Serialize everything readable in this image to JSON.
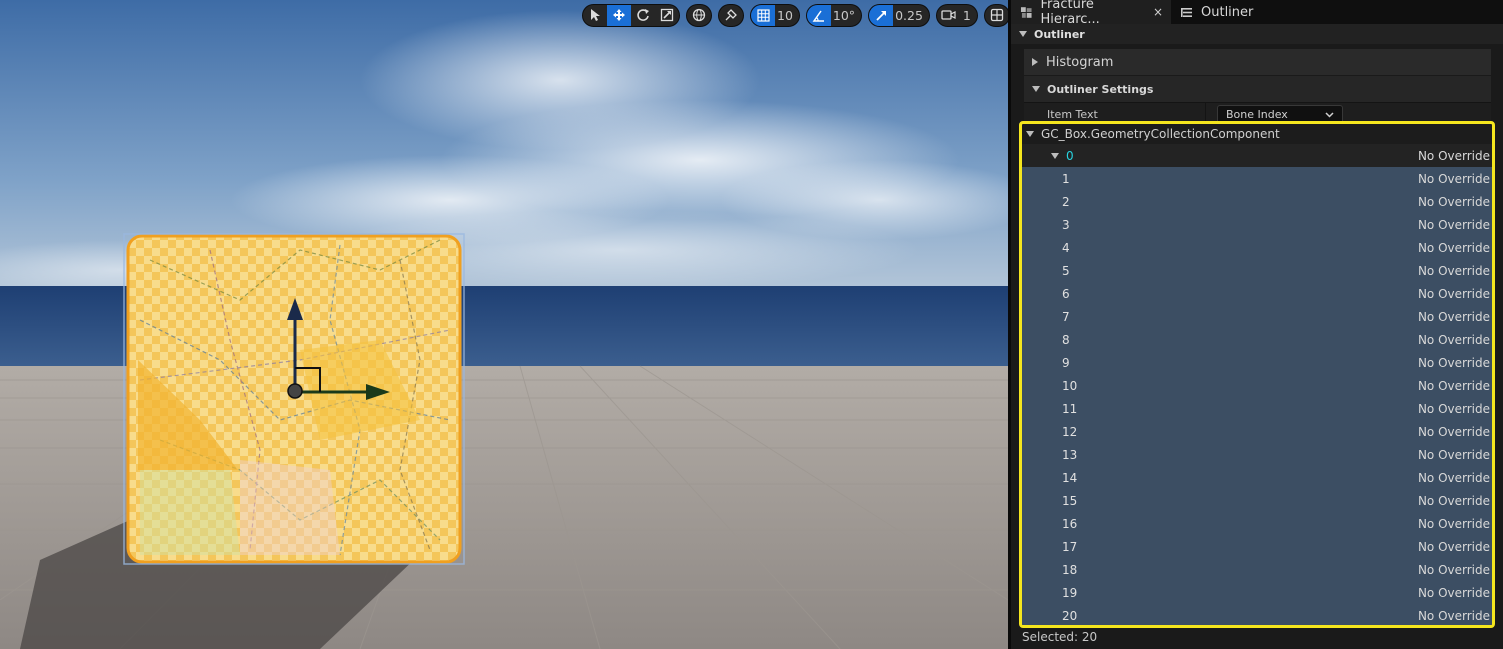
{
  "toolbar": {
    "grid_snap_value": "10",
    "rotation_snap_value": "10°",
    "scale_snap_value": "0.25",
    "camera_speed_value": "1"
  },
  "tabs": [
    {
      "label": "Fracture Hierarc...",
      "icon": "fracture-hierarchy-icon",
      "close": "×"
    },
    {
      "label": "Outliner",
      "icon": "outliner-icon"
    }
  ],
  "outliner": {
    "title": "Outliner",
    "histogram_label": "Histogram",
    "settings_label": "Outliner Settings",
    "item_text_label": "Item Text",
    "item_text_value": "Bone Index"
  },
  "tree": {
    "root_label": "GC_Box.GeometryCollectionComponent",
    "parent": {
      "index": "0",
      "override": "No Override"
    },
    "rows": [
      {
        "index": "1",
        "override": "No Override"
      },
      {
        "index": "2",
        "override": "No Override"
      },
      {
        "index": "3",
        "override": "No Override"
      },
      {
        "index": "4",
        "override": "No Override"
      },
      {
        "index": "5",
        "override": "No Override"
      },
      {
        "index": "6",
        "override": "No Override"
      },
      {
        "index": "7",
        "override": "No Override"
      },
      {
        "index": "8",
        "override": "No Override"
      },
      {
        "index": "9",
        "override": "No Override"
      },
      {
        "index": "10",
        "override": "No Override"
      },
      {
        "index": "11",
        "override": "No Override"
      },
      {
        "index": "12",
        "override": "No Override"
      },
      {
        "index": "13",
        "override": "No Override"
      },
      {
        "index": "14",
        "override": "No Override"
      },
      {
        "index": "15",
        "override": "No Override"
      },
      {
        "index": "16",
        "override": "No Override"
      },
      {
        "index": "17",
        "override": "No Override"
      },
      {
        "index": "18",
        "override": "No Override"
      },
      {
        "index": "19",
        "override": "No Override"
      },
      {
        "index": "20",
        "override": "No Override"
      }
    ]
  },
  "status": {
    "selected_text": "Selected: 20"
  },
  "colors": {
    "accent": "#1a6fd6",
    "selection": "#3c4e63",
    "highlight_frame": "#f5e61e",
    "parent_index": "#27d3e0"
  }
}
